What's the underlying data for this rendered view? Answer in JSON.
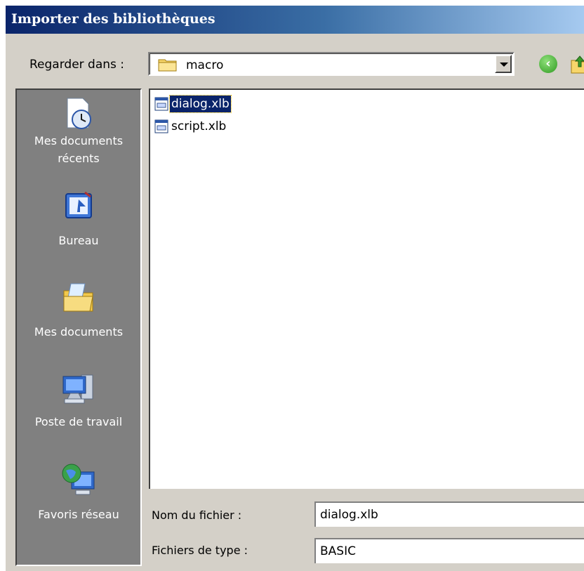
{
  "window": {
    "title": "Importer des bibliothèques"
  },
  "lookin": {
    "label": "Regarder dans :",
    "value": "macro",
    "dropdown_icon": "chevron-down-icon",
    "back_icon": "back-arrow-icon",
    "up_icon": "folder-up-icon"
  },
  "places": [
    {
      "label_line1": "Mes documents",
      "label_line2": "récents",
      "icon": "recent-documents-icon"
    },
    {
      "label_line1": "Bureau",
      "label_line2": "",
      "icon": "desktop-icon"
    },
    {
      "label_line1": "Mes documents",
      "label_line2": "",
      "icon": "my-documents-icon"
    },
    {
      "label_line1": "Poste de travail",
      "label_line2": "",
      "icon": "my-computer-icon"
    },
    {
      "label_line1": "Favoris réseau",
      "label_line2": "",
      "icon": "network-places-icon"
    }
  ],
  "files": [
    {
      "name": "dialog.xlb",
      "selected": true,
      "icon": "library-file-icon"
    },
    {
      "name": "script.xlb",
      "selected": false,
      "icon": "library-file-icon"
    }
  ],
  "filename": {
    "label": "Nom du fichier :",
    "value": "dialog.xlb"
  },
  "filetype": {
    "label": "Fichiers de type :",
    "value": "BASIC"
  },
  "colors": {
    "title_start": "#0a246a",
    "title_end": "#a6caf0",
    "face": "#d4d0c8",
    "places_bg": "#808080",
    "selection": "#0a246a"
  }
}
